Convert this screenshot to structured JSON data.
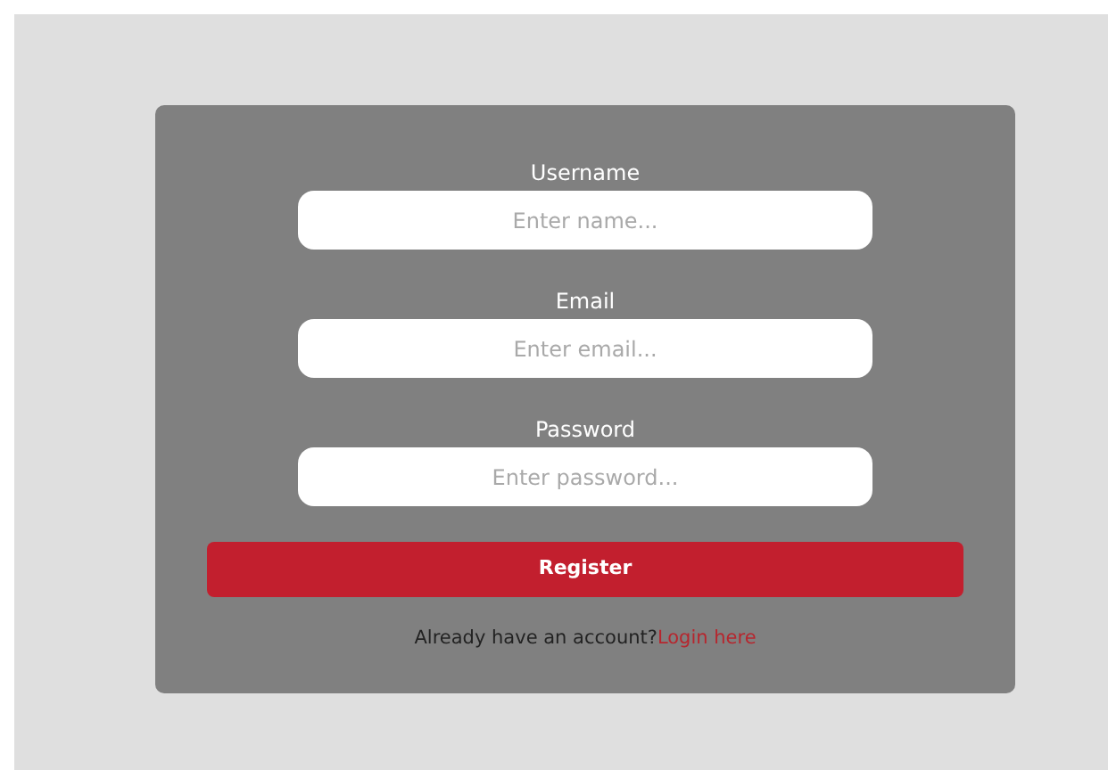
{
  "form": {
    "fields": [
      {
        "label": "Username",
        "placeholder": "Enter name..."
      },
      {
        "label": "Email",
        "placeholder": "Enter email..."
      },
      {
        "label": "Password",
        "placeholder": "Enter password..."
      }
    ],
    "submit": "Register",
    "footer": {
      "text": "Already have an account?",
      "link": "Login here"
    }
  }
}
